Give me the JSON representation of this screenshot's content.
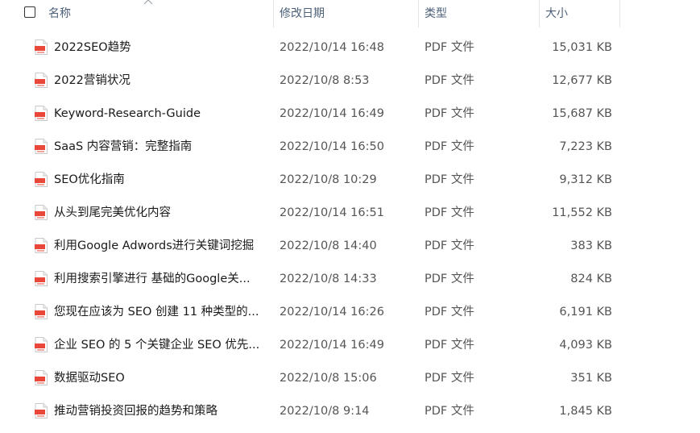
{
  "header": {
    "name": "名称",
    "date_modified": "修改日期",
    "type": "类型",
    "size": "大小"
  },
  "colors": {
    "pdf_icon": "#e8473a",
    "header_text": "#4c607a"
  },
  "icons": {
    "file": "pdf-file-icon",
    "sort": "sort-up-arrow-icon",
    "select_all": "checkbox-icon"
  },
  "files": [
    {
      "name": "2022SEO趋势",
      "date": "2022/10/14 16:48",
      "type": "PDF 文件",
      "size": "15,031 KB"
    },
    {
      "name": "2022营销状况",
      "date": "2022/10/8 8:53",
      "type": "PDF 文件",
      "size": "12,677 KB"
    },
    {
      "name": "Keyword-Research-Guide",
      "date": "2022/10/14 16:49",
      "type": "PDF 文件",
      "size": "15,687 KB"
    },
    {
      "name": "SaaS 内容营销：完整指南",
      "date": "2022/10/14 16:50",
      "type": "PDF 文件",
      "size": "7,223 KB"
    },
    {
      "name": "SEO优化指南",
      "date": "2022/10/8 10:29",
      "type": "PDF 文件",
      "size": "9,312 KB"
    },
    {
      "name": "从头到尾完美优化内容",
      "date": "2022/10/14 16:51",
      "type": "PDF 文件",
      "size": "11,552 KB"
    },
    {
      "name": "利用Google Adwords进行关键词挖掘",
      "date": "2022/10/8 14:40",
      "type": "PDF 文件",
      "size": "383 KB"
    },
    {
      "name": "利用搜索引擎进行 基础的Google关...",
      "date": "2022/10/8 14:33",
      "type": "PDF 文件",
      "size": "824 KB"
    },
    {
      "name": "您现在应该为 SEO 创建 11 种类型的...",
      "date": "2022/10/14 16:26",
      "type": "PDF 文件",
      "size": "6,191 KB"
    },
    {
      "name": "企业 SEO 的 5 个关键企业 SEO 优先...",
      "date": "2022/10/14 16:49",
      "type": "PDF 文件",
      "size": "4,093 KB"
    },
    {
      "name": "数据驱动SEO",
      "date": "2022/10/8 15:06",
      "type": "PDF 文件",
      "size": "351 KB"
    },
    {
      "name": "推动营销投资回报的趋势和策略",
      "date": "2022/10/8 9:14",
      "type": "PDF 文件",
      "size": "1,845 KB"
    }
  ]
}
